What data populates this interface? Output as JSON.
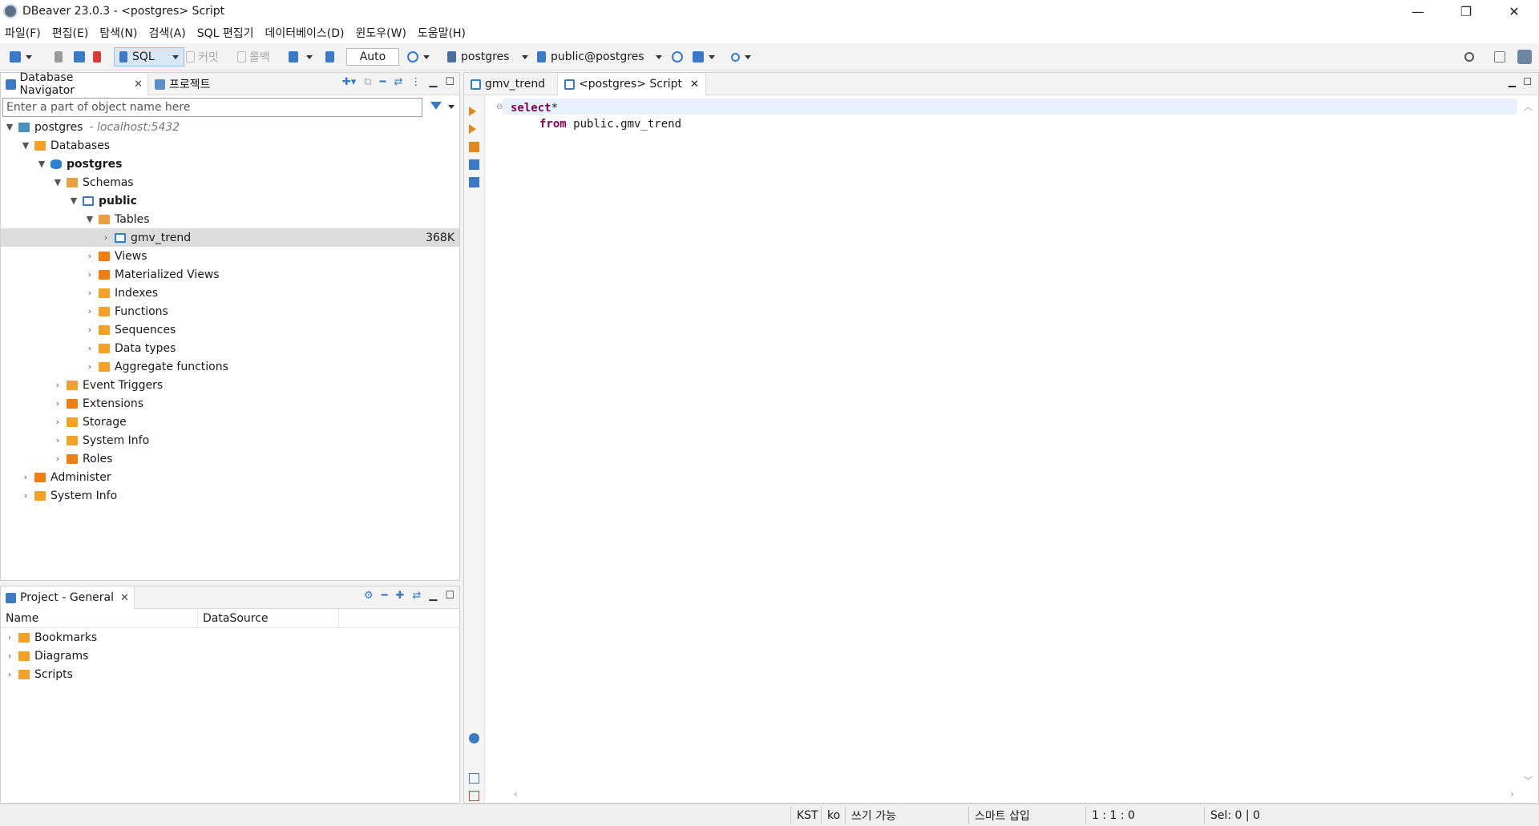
{
  "window": {
    "title": "DBeaver 23.0.3 - <postgres> Script",
    "controls": [
      "—",
      "❐",
      "✕"
    ]
  },
  "menu": [
    "파일(F)",
    "편집(E)",
    "탐색(N)",
    "검색(A)",
    "SQL 편집기",
    "데이터베이스(D)",
    "윈도우(W)",
    "도움말(H)"
  ],
  "toolbar": {
    "sql_label": "SQL",
    "commit_label": "커밋",
    "rollback_label": "롤백",
    "transaction_mode": "Auto",
    "datasource": "postgres",
    "schema": "public@postgres"
  },
  "navigator": {
    "tab_label": "Database Navigator",
    "project_tab_label": "프로젝트",
    "filter_placeholder": "Enter a part of object name here",
    "tree": {
      "connection": "postgres",
      "host": "- localhost:5432",
      "databases": "Databases",
      "database": "postgres",
      "schemas": "Schemas",
      "schema": "public",
      "tables": "Tables",
      "table": "gmv_trend",
      "table_size": "368K",
      "schema_children": [
        "Views",
        "Materialized Views",
        "Indexes",
        "Functions",
        "Sequences",
        "Data types",
        "Aggregate functions"
      ],
      "db_children": [
        "Event Triggers",
        "Extensions",
        "Storage",
        "System Info",
        "Roles"
      ],
      "conn_children": [
        "Administer",
        "System Info"
      ]
    }
  },
  "project": {
    "tab_label": "Project - General",
    "col_name": "Name",
    "col_datasource": "DataSource",
    "items": [
      "Bookmarks",
      "Diagrams",
      "Scripts"
    ]
  },
  "editor": {
    "tabs": [
      "gmv_trend",
      "<postgres> Script"
    ],
    "code": {
      "line1_kw": "select",
      "line1_rest": "*",
      "line2_kw": "from",
      "line2_rest": " public.gmv_trend"
    }
  },
  "statusbar": {
    "timezone": "KST",
    "locale": "ko",
    "writable": "쓰기 가능",
    "insert_mode": "스마트 삽입",
    "position": "1 : 1 : 0",
    "selection": "Sel: 0 | 0"
  }
}
